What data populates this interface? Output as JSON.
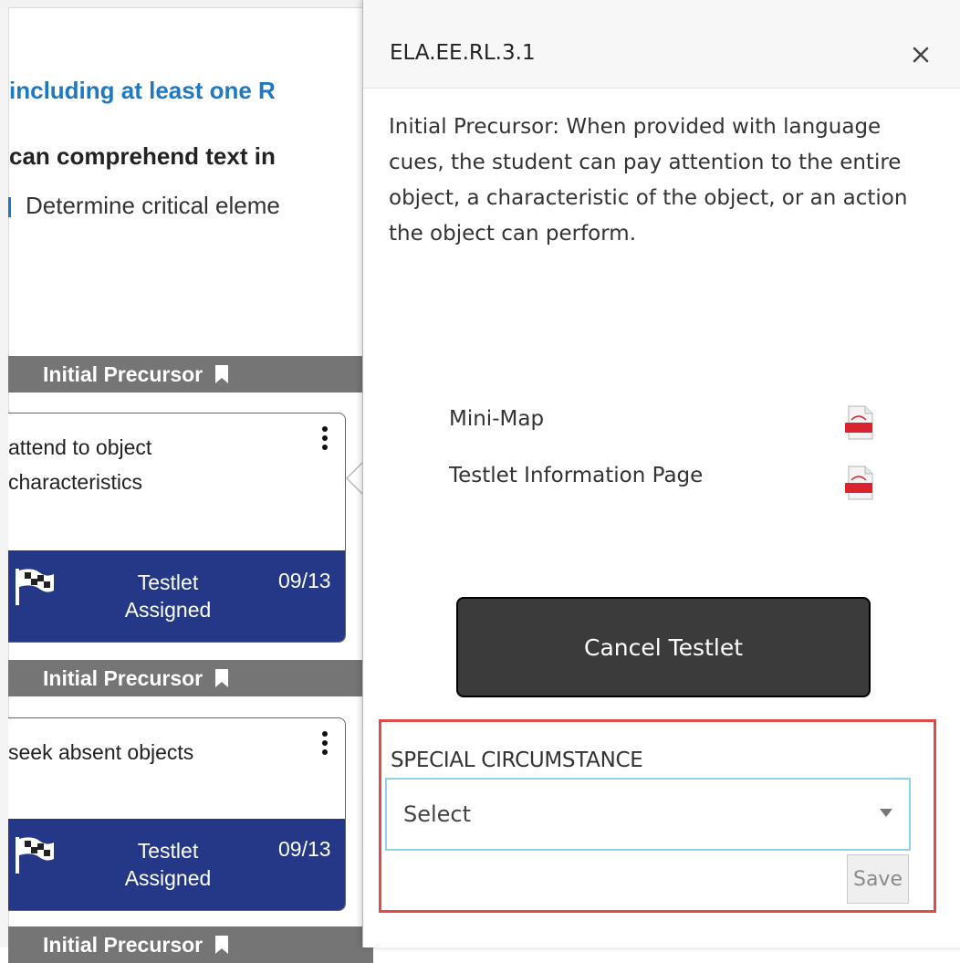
{
  "background": {
    "heading_fragment": "including at least one R",
    "bold_fragment": "can comprehend text in",
    "normal_fragment": "Determine critical eleme",
    "levels": [
      {
        "label": "Initial Precursor"
      },
      {
        "label": "Initial Precursor"
      },
      {
        "label": "Initial Precursor"
      }
    ],
    "cards": [
      {
        "text": "attend to object\ncharacteristics",
        "status": "Testlet\nAssigned",
        "date": "09/13"
      },
      {
        "text": "seek absent objects",
        "status": "Testlet\nAssigned",
        "date": "09/13"
      }
    ]
  },
  "popover": {
    "title": "ELA.EE.RL.3.1",
    "description": "Initial Precursor: When provided with language cues, the student can pay attention to the entire object, a characteristic of the object, or an action the object can perform.",
    "documents": [
      {
        "label": "Mini-Map",
        "icon": "pdf-icon"
      },
      {
        "label": "Testlet Information Page",
        "icon": "pdf-icon"
      }
    ],
    "cancel_label": "Cancel Testlet",
    "special_circumstance": {
      "label": "SPECIAL CIRCUMSTANCE",
      "selected": "Select",
      "save_label": "Save"
    }
  },
  "colors": {
    "status_bg": "#253888",
    "level_bg": "#757575",
    "heading_blue": "#1f78c2",
    "highlight": "#e24a4a",
    "select_border": "#8fd3ea",
    "cancel_bg": "#3b3b3b"
  }
}
